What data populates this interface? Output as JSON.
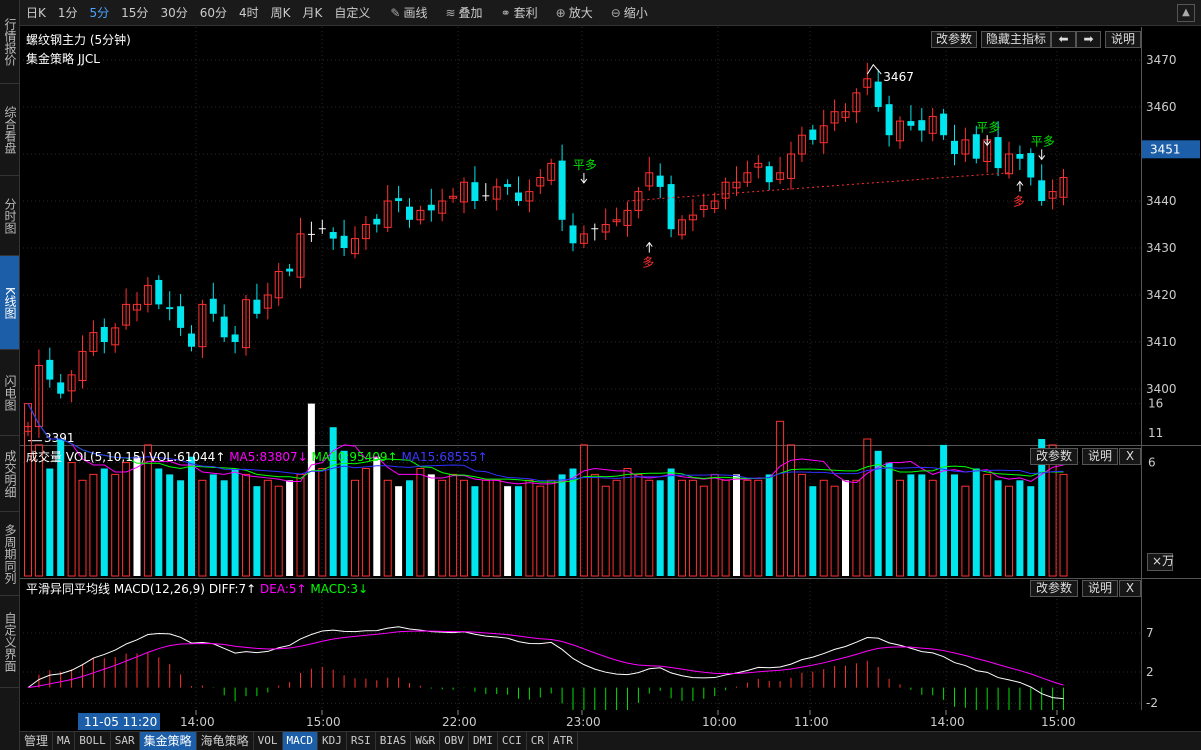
{
  "left_nav": [
    {
      "label": "行情报价",
      "active": false
    },
    {
      "label": "综合看盘",
      "active": false
    },
    {
      "label": "分时图",
      "active": false
    },
    {
      "label": "K线图",
      "active": true
    },
    {
      "label": "闪电图",
      "active": false
    },
    {
      "label": "成交明细",
      "active": false
    },
    {
      "label": "多周期同列",
      "active": false
    },
    {
      "label": "自定义界面",
      "active": false
    }
  ],
  "toolbar": {
    "periods": [
      {
        "label": "日K",
        "active": false
      },
      {
        "label": "1分",
        "active": false
      },
      {
        "label": "5分",
        "active": true
      },
      {
        "label": "15分",
        "active": false
      },
      {
        "label": "30分",
        "active": false
      },
      {
        "label": "60分",
        "active": false
      },
      {
        "label": "4时",
        "active": false
      },
      {
        "label": "周K",
        "active": false
      },
      {
        "label": "月K",
        "active": false
      },
      {
        "label": "自定义",
        "active": false
      }
    ],
    "tools": [
      {
        "label": "画线",
        "icon": "pencil-icon",
        "glyph": "✎"
      },
      {
        "label": "叠加",
        "icon": "stack-icon",
        "glyph": "≋"
      },
      {
        "label": "套利",
        "icon": "arbitrage-icon",
        "glyph": "⚭"
      },
      {
        "label": "放大",
        "icon": "zoom-in-icon",
        "glyph": "⊕"
      },
      {
        "label": "缩小",
        "icon": "zoom-out-icon",
        "glyph": "⊖"
      }
    ],
    "scroll_glyph": "▲"
  },
  "main_panel": {
    "title": "螺纹钢主力 (5分钟)",
    "strategy": "集金策略 JJCL",
    "buttons": {
      "params": "改参数",
      "hide": "隐藏主指标",
      "left": "⬅",
      "right": "➡",
      "help": "说明"
    },
    "price_ticks": [
      "3470",
      "3460",
      "3450",
      "3440",
      "3430",
      "3420",
      "3410",
      "3400"
    ],
    "current_price": "3451",
    "high_label": "3467",
    "low_label": "3391",
    "signals": {
      "buy": "多",
      "close": "平多"
    }
  },
  "vol_panel": {
    "name": "成交量",
    "params": "VOL(5,10,15)",
    "vol": "VOL:61044↑",
    "ma5": "MA5:83807↓",
    "ma10": "MA10:95409↑",
    "ma15": "MA15:68555↑",
    "ticks": [
      "16",
      "11",
      "6"
    ],
    "unit": "×万",
    "buttons": {
      "params": "改参数",
      "help": "说明",
      "close": "X"
    }
  },
  "macd_panel": {
    "name": "平滑异同平均线",
    "params": "MACD(12,26,9)",
    "diff": "DIFF:7↑",
    "dea": "DEA:5↑",
    "macd": "MACD:3↓",
    "ticks": [
      "7",
      "2",
      "-2"
    ],
    "buttons": {
      "params": "改参数",
      "help": "说明",
      "close": "X"
    }
  },
  "time_axis": {
    "cursor_label": "11-05 11:20",
    "labels": [
      "14:00",
      "15:00",
      "22:00",
      "23:00",
      "10:00",
      "11:00",
      "14:00",
      "15:00"
    ]
  },
  "bottom_tabs": [
    {
      "label": "管理",
      "active": false
    },
    {
      "label": "MA",
      "active": false
    },
    {
      "label": "BOLL",
      "active": false
    },
    {
      "label": "SAR",
      "active": false
    },
    {
      "label": "集金策略",
      "active": true
    },
    {
      "label": "海龟策略",
      "active": false
    },
    {
      "label": "VOL",
      "active": false
    },
    {
      "label": "MACD",
      "active": true
    },
    {
      "label": "KDJ",
      "active": false
    },
    {
      "label": "RSI",
      "active": false
    },
    {
      "label": "BIAS",
      "active": false
    },
    {
      "label": "W&R",
      "active": false
    },
    {
      "label": "OBV",
      "active": false
    },
    {
      "label": "DMI",
      "active": false
    },
    {
      "label": "CCI",
      "active": false
    },
    {
      "label": "CR",
      "active": false
    },
    {
      "label": "ATR",
      "active": false
    }
  ],
  "colors": {
    "up": "#ff3030",
    "down": "#00e5ee",
    "flat": "#ffffff",
    "ma5": "#ff00ff",
    "ma10": "#00ff00",
    "ma15": "#3030ff",
    "diff": "#ffffff",
    "dea": "#ff00ff",
    "grid": "#2a2a2a",
    "accent": "#1c5fa8"
  }
}
